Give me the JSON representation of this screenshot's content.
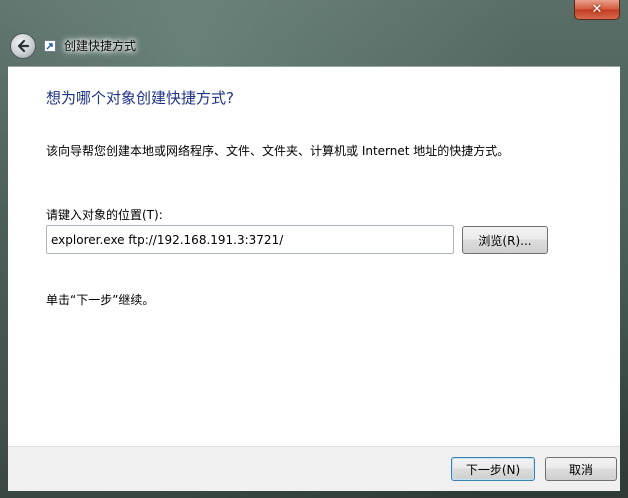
{
  "window": {
    "title": "创建快捷方式",
    "close_glyph": "✕",
    "back_glyph": "◀"
  },
  "main": {
    "heading": "想为哪个对象创建快捷方式?",
    "description": "该向导帮您创建本地或网络程序、文件、文件夹、计算机或 Internet 地址的快捷方式。",
    "field_label": "请键入对象的位置(T):",
    "location_value": "explorer.exe ftp://192.168.191.3:3721/",
    "browse_label": "浏览(R)...",
    "hint": "单击“下一步”继续。"
  },
  "footer": {
    "next_label": "下一步(N)",
    "cancel_label": "取消"
  },
  "colors": {
    "heading": "#1e3287",
    "close_button": "#c94a2e",
    "footer_bg": "#f0f0f0"
  },
  "icons": [
    "close-icon",
    "back-arrow-icon",
    "shortcut-icon"
  ]
}
